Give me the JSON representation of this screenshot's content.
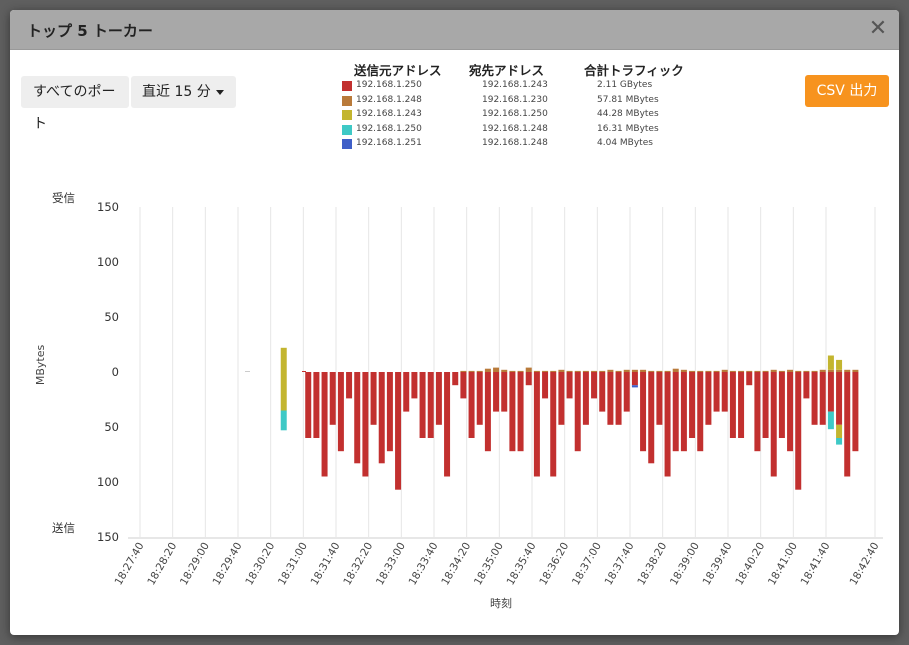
{
  "dialog": {
    "title": "トップ 5 トーカー",
    "close_label": "✕"
  },
  "toolbar": {
    "ports_label": "すべてのポート",
    "range_label": "直近 15 分",
    "csv_label": "CSV 出力"
  },
  "legend": {
    "headers": {
      "src": "送信元アドレス",
      "dst": "宛先アドレス",
      "traffic": "合計トラフィック"
    },
    "rows": [
      {
        "color": "#c2302f",
        "src": "192.168.1.250",
        "dst": "192.168.1.243",
        "traffic": "2.11 GBytes"
      },
      {
        "color": "#b97a3a",
        "src": "192.168.1.248",
        "dst": "192.168.1.230",
        "traffic": "57.81 MBytes"
      },
      {
        "color": "#c3b52f",
        "src": "192.168.1.243",
        "dst": "192.168.1.250",
        "traffic": "44.28 MBytes"
      },
      {
        "color": "#3ec9c6",
        "src": "192.168.1.250",
        "dst": "192.168.1.248",
        "traffic": "16.31 MBytes"
      },
      {
        "color": "#3f5fc8",
        "src": "192.168.1.251",
        "dst": "192.168.1.248",
        "traffic": "4.04 MBytes"
      }
    ]
  },
  "chart_data": {
    "type": "bar",
    "stacked": true,
    "diverging": true,
    "ylabel": "MBytes",
    "xlabel": "時刻",
    "y_top_label": "受信",
    "y_bottom_label": "送信",
    "ylim": [
      -150,
      150
    ],
    "yticks": [
      {
        "value": 150,
        "label": "150"
      },
      {
        "value": 100,
        "label": "100"
      },
      {
        "value": 50,
        "label": "50"
      },
      {
        "value": 0,
        "label": "0"
      },
      {
        "value": -50,
        "label": "50"
      },
      {
        "value": -100,
        "label": "100"
      },
      {
        "value": -150,
        "label": "150"
      }
    ],
    "x_tick_labels": [
      "18:27:40",
      "18:28:20",
      "18:29:00",
      "18:29:40",
      "18:30:20",
      "18:31:00",
      "18:31:40",
      "18:32:20",
      "18:33:00",
      "18:33:40",
      "18:34:20",
      "18:35:00",
      "18:35:40",
      "18:36:20",
      "18:37:00",
      "18:37:40",
      "18:38:20",
      "18:39:00",
      "18:39:40",
      "18:40:20",
      "18:41:00",
      "18:41:40",
      "18:42:40"
    ],
    "grid": true,
    "series_colors": [
      "#c2302f",
      "#b97a3a",
      "#c3b52f",
      "#3ec9c6",
      "#3f5fc8"
    ],
    "points": [
      {
        "t": "18:30:36",
        "rx": [
          0,
          0,
          22,
          0,
          0
        ],
        "tx": [
          0,
          0,
          35,
          18,
          0
        ]
      },
      {
        "t": "18:31:06",
        "rx": [
          0,
          0,
          0,
          0,
          0
        ],
        "tx": [
          60,
          0,
          0,
          0,
          0
        ]
      },
      {
        "t": "18:31:16",
        "rx": [
          0,
          0,
          0,
          0,
          0
        ],
        "tx": [
          60,
          0,
          0,
          0,
          0
        ]
      },
      {
        "t": "18:31:26",
        "rx": [
          0,
          0,
          0,
          0,
          0
        ],
        "tx": [
          95,
          0,
          0,
          0,
          0
        ]
      },
      {
        "t": "18:31:36",
        "rx": [
          0,
          0,
          0,
          0,
          0
        ],
        "tx": [
          48,
          0,
          0,
          0,
          0
        ]
      },
      {
        "t": "18:31:46",
        "rx": [
          0,
          0,
          0,
          0,
          0
        ],
        "tx": [
          72,
          0,
          0,
          0,
          0
        ]
      },
      {
        "t": "18:31:56",
        "rx": [
          0,
          0,
          0,
          0,
          0
        ],
        "tx": [
          24,
          0,
          0,
          0,
          0
        ]
      },
      {
        "t": "18:32:06",
        "rx": [
          0,
          0,
          0,
          0,
          0
        ],
        "tx": [
          83,
          0,
          0,
          0,
          0
        ]
      },
      {
        "t": "18:32:16",
        "rx": [
          0,
          0,
          0,
          0,
          0
        ],
        "tx": [
          95,
          0,
          0,
          0,
          0
        ]
      },
      {
        "t": "18:32:26",
        "rx": [
          0,
          0,
          0,
          0,
          0
        ],
        "tx": [
          48,
          0,
          0,
          0,
          0
        ]
      },
      {
        "t": "18:32:36",
        "rx": [
          0,
          0,
          0,
          0,
          0
        ],
        "tx": [
          83,
          0,
          0,
          0,
          0
        ]
      },
      {
        "t": "18:32:46",
        "rx": [
          0,
          0,
          0,
          0,
          0
        ],
        "tx": [
          72,
          0,
          0,
          0,
          0
        ]
      },
      {
        "t": "18:32:56",
        "rx": [
          0,
          0,
          0,
          0,
          0
        ],
        "tx": [
          107,
          0,
          0,
          0,
          0
        ]
      },
      {
        "t": "18:33:06",
        "rx": [
          0,
          0,
          0,
          0,
          0
        ],
        "tx": [
          36,
          0,
          0,
          0,
          0
        ]
      },
      {
        "t": "18:33:16",
        "rx": [
          0,
          0,
          0,
          0,
          0
        ],
        "tx": [
          24,
          0,
          0,
          0,
          0
        ]
      },
      {
        "t": "18:33:26",
        "rx": [
          0,
          0,
          0,
          0,
          0
        ],
        "tx": [
          60,
          0,
          0,
          0,
          0
        ]
      },
      {
        "t": "18:33:36",
        "rx": [
          0,
          0,
          0,
          0,
          0
        ],
        "tx": [
          60,
          0,
          0,
          0,
          0
        ]
      },
      {
        "t": "18:33:46",
        "rx": [
          0,
          0,
          0,
          0,
          0
        ],
        "tx": [
          48,
          0,
          0,
          0,
          0
        ]
      },
      {
        "t": "18:33:56",
        "rx": [
          0,
          0,
          0,
          0,
          0
        ],
        "tx": [
          95,
          0,
          0,
          0,
          0
        ]
      },
      {
        "t": "18:34:06",
        "rx": [
          0,
          0,
          0,
          0,
          0
        ],
        "tx": [
          12,
          0,
          0,
          0,
          0
        ]
      },
      {
        "t": "18:34:16",
        "rx": [
          0,
          1,
          0,
          0,
          0
        ],
        "tx": [
          24,
          0,
          0,
          0,
          0
        ]
      },
      {
        "t": "18:34:26",
        "rx": [
          0,
          1,
          0,
          0,
          0
        ],
        "tx": [
          60,
          0,
          0,
          0,
          0
        ]
      },
      {
        "t": "18:34:36",
        "rx": [
          0,
          1,
          0,
          0,
          0
        ],
        "tx": [
          48,
          0,
          0,
          0,
          0
        ]
      },
      {
        "t": "18:34:46",
        "rx": [
          0,
          3,
          0,
          0,
          0
        ],
        "tx": [
          72,
          0,
          0,
          0,
          0
        ]
      },
      {
        "t": "18:34:56",
        "rx": [
          0,
          4,
          0,
          0,
          0
        ],
        "tx": [
          36,
          0,
          0,
          0,
          0
        ]
      },
      {
        "t": "18:35:06",
        "rx": [
          0,
          2,
          0,
          0,
          0
        ],
        "tx": [
          36,
          0,
          0,
          0,
          0
        ]
      },
      {
        "t": "18:35:16",
        "rx": [
          0,
          1,
          0,
          0,
          0
        ],
        "tx": [
          72,
          0,
          0,
          0,
          0
        ]
      },
      {
        "t": "18:35:26",
        "rx": [
          0,
          1,
          0,
          0,
          0
        ],
        "tx": [
          72,
          0,
          0,
          0,
          0
        ]
      },
      {
        "t": "18:35:36",
        "rx": [
          0,
          4,
          0,
          0,
          0
        ],
        "tx": [
          12,
          0,
          0,
          0,
          0
        ]
      },
      {
        "t": "18:35:46",
        "rx": [
          0,
          1,
          0,
          0,
          0
        ],
        "tx": [
          95,
          0,
          0,
          0,
          0
        ]
      },
      {
        "t": "18:35:56",
        "rx": [
          0,
          1,
          0,
          0,
          0
        ],
        "tx": [
          24,
          0,
          0,
          0,
          0
        ]
      },
      {
        "t": "18:36:06",
        "rx": [
          0,
          1,
          0,
          0,
          0
        ],
        "tx": [
          95,
          0,
          0,
          0,
          0
        ]
      },
      {
        "t": "18:36:16",
        "rx": [
          0,
          2,
          0,
          0,
          0
        ],
        "tx": [
          48,
          0,
          0,
          0,
          0
        ]
      },
      {
        "t": "18:36:26",
        "rx": [
          0,
          1,
          0,
          0,
          0
        ],
        "tx": [
          24,
          0,
          0,
          0,
          0
        ]
      },
      {
        "t": "18:36:36",
        "rx": [
          0,
          1,
          0,
          0,
          0
        ],
        "tx": [
          72,
          0,
          0,
          0,
          0
        ]
      },
      {
        "t": "18:36:46",
        "rx": [
          0,
          1,
          0,
          0,
          0
        ],
        "tx": [
          48,
          0,
          0,
          0,
          0
        ]
      },
      {
        "t": "18:36:56",
        "rx": [
          0,
          1,
          0,
          0,
          0
        ],
        "tx": [
          24,
          0,
          0,
          0,
          0
        ]
      },
      {
        "t": "18:37:06",
        "rx": [
          0,
          1,
          0,
          0,
          0
        ],
        "tx": [
          36,
          0,
          0,
          0,
          0
        ]
      },
      {
        "t": "18:37:16",
        "rx": [
          0,
          2,
          0,
          0,
          0
        ],
        "tx": [
          48,
          0,
          0,
          0,
          0
        ]
      },
      {
        "t": "18:37:26",
        "rx": [
          0,
          1,
          0,
          0,
          0
        ],
        "tx": [
          48,
          0,
          0,
          0,
          0
        ]
      },
      {
        "t": "18:37:36",
        "rx": [
          0,
          2,
          0,
          0,
          0
        ],
        "tx": [
          36,
          0,
          0,
          0,
          0
        ]
      },
      {
        "t": "18:37:46",
        "rx": [
          0,
          2,
          0,
          0,
          0
        ],
        "tx": [
          12,
          0,
          0,
          0,
          0,
          2
        ]
      },
      {
        "t": "18:37:56",
        "rx": [
          0,
          2,
          0,
          0,
          0
        ],
        "tx": [
          72,
          0,
          0,
          0,
          0
        ]
      },
      {
        "t": "18:38:06",
        "rx": [
          0,
          1,
          0,
          0,
          0
        ],
        "tx": [
          83,
          0,
          0,
          0,
          0
        ]
      },
      {
        "t": "18:38:16",
        "rx": [
          0,
          1,
          0,
          0,
          0
        ],
        "tx": [
          48,
          0,
          0,
          0,
          0
        ]
      },
      {
        "t": "18:38:26",
        "rx": [
          0,
          1,
          0,
          0,
          0
        ],
        "tx": [
          95,
          0,
          0,
          0,
          0
        ]
      },
      {
        "t": "18:38:36",
        "rx": [
          0,
          3,
          0,
          0,
          0
        ],
        "tx": [
          72,
          0,
          0,
          0,
          0
        ]
      },
      {
        "t": "18:38:46",
        "rx": [
          0,
          2,
          0,
          0,
          0
        ],
        "tx": [
          72,
          0,
          0,
          0,
          0
        ]
      },
      {
        "t": "18:38:56",
        "rx": [
          0,
          1,
          0,
          0,
          0
        ],
        "tx": [
          60,
          0,
          0,
          0,
          0
        ]
      },
      {
        "t": "18:39:06",
        "rx": [
          0,
          1,
          0,
          0,
          0
        ],
        "tx": [
          72,
          0,
          0,
          0,
          0
        ]
      },
      {
        "t": "18:39:16",
        "rx": [
          0,
          1,
          0,
          0,
          0
        ],
        "tx": [
          48,
          0,
          0,
          0,
          0
        ]
      },
      {
        "t": "18:39:26",
        "rx": [
          0,
          1,
          0,
          0,
          0
        ],
        "tx": [
          36,
          0,
          0,
          0,
          0
        ]
      },
      {
        "t": "18:39:36",
        "rx": [
          0,
          2,
          0,
          0,
          0
        ],
        "tx": [
          36,
          0,
          0,
          0,
          0
        ]
      },
      {
        "t": "18:39:46",
        "rx": [
          0,
          1,
          0,
          0,
          0
        ],
        "tx": [
          60,
          0,
          0,
          0,
          0
        ]
      },
      {
        "t": "18:39:56",
        "rx": [
          0,
          1,
          0,
          0,
          0
        ],
        "tx": [
          60,
          0,
          0,
          0,
          0
        ]
      },
      {
        "t": "18:40:06",
        "rx": [
          0,
          1,
          0,
          0,
          0
        ],
        "tx": [
          12,
          0,
          0,
          0,
          0
        ]
      },
      {
        "t": "18:40:16",
        "rx": [
          0,
          1,
          0,
          0,
          0
        ],
        "tx": [
          72,
          0,
          0,
          0,
          0
        ]
      },
      {
        "t": "18:40:26",
        "rx": [
          0,
          1,
          0,
          0,
          0
        ],
        "tx": [
          60,
          0,
          0,
          0,
          0
        ]
      },
      {
        "t": "18:40:36",
        "rx": [
          0,
          2,
          0,
          0,
          0
        ],
        "tx": [
          95,
          0,
          0,
          0,
          0
        ]
      },
      {
        "t": "18:40:46",
        "rx": [
          0,
          1,
          0,
          0,
          0
        ],
        "tx": [
          60,
          0,
          0,
          0,
          0
        ]
      },
      {
        "t": "18:40:56",
        "rx": [
          0,
          2,
          0,
          0,
          0
        ],
        "tx": [
          72,
          0,
          0,
          0,
          0
        ]
      },
      {
        "t": "18:41:06",
        "rx": [
          0,
          1,
          0,
          0,
          0
        ],
        "tx": [
          107,
          0,
          0,
          0,
          0
        ]
      },
      {
        "t": "18:41:16",
        "rx": [
          0,
          1,
          0,
          0,
          0
        ],
        "tx": [
          24,
          0,
          0,
          0,
          0
        ]
      },
      {
        "t": "18:41:26",
        "rx": [
          0,
          1,
          0,
          0,
          0
        ],
        "tx": [
          48,
          0,
          0,
          0,
          0
        ]
      },
      {
        "t": "18:41:36",
        "rx": [
          0,
          2,
          0,
          0,
          0
        ],
        "tx": [
          48,
          0,
          0,
          0,
          0
        ]
      },
      {
        "t": "18:41:46",
        "rx": [
          0,
          2,
          13,
          0,
          0
        ],
        "tx": [
          36,
          0,
          0,
          16,
          0
        ]
      },
      {
        "t": "18:41:56",
        "rx": [
          0,
          2,
          9,
          0,
          0
        ],
        "tx": [
          48,
          0,
          12,
          6,
          0
        ]
      },
      {
        "t": "18:42:06",
        "rx": [
          0,
          2,
          0,
          0,
          0
        ],
        "tx": [
          95,
          0,
          0,
          0,
          0
        ]
      },
      {
        "t": "18:42:16",
        "rx": [
          0,
          2,
          0,
          0,
          0
        ],
        "tx": [
          72,
          0,
          0,
          0,
          0
        ]
      }
    ],
    "timeline_start": "18:27:20",
    "timeline_end": "18:42:50"
  }
}
